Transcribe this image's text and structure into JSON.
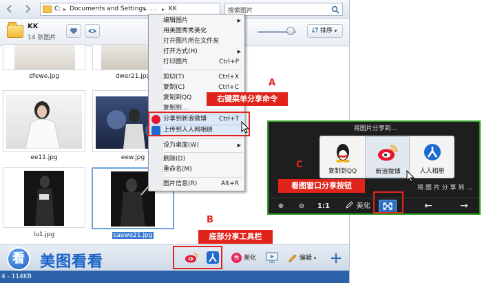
{
  "explorer": {
    "nav": {
      "back_glyph": "◄",
      "forward_glyph": "►",
      "back_icon": "back-arrow-icon",
      "forward_icon": "forward-arrow-icon"
    },
    "address": {
      "drive": "C:",
      "segment1": "Documents and Settings",
      "segment2": "...",
      "segment3": "KK"
    },
    "search": {
      "placeholder": "搜索图片",
      "icon": "search-icon"
    },
    "folder": {
      "name": "KK",
      "count": "14 张图片"
    },
    "sort_label": "排序",
    "zoom_level": 0.85,
    "thumbnails": [
      {
        "name": "dfewe.jpg",
        "selected": false
      },
      {
        "name": "dwer21.jpg",
        "selected": false
      },
      {
        "name": "ee11.jpg",
        "selected": false
      },
      {
        "name": "eew.jpg",
        "selected": false
      },
      {
        "name": "lu1.jpg",
        "selected": false
      },
      {
        "name": "saewe21.jpg",
        "selected": true
      }
    ],
    "bottom": {
      "logo_glyph": "看",
      "logo_text": "美图看看",
      "beautify_label": "美化",
      "edit_label": "编辑"
    },
    "status_text": "4 - 114KB"
  },
  "context_menu": {
    "items": [
      {
        "label": "编辑图片",
        "shortcut": "",
        "submenu": true
      },
      {
        "label": "用美图秀秀美化",
        "shortcut": "",
        "submenu": false
      },
      {
        "label": "打开图片所在文件夹",
        "shortcut": "",
        "submenu": false
      },
      {
        "label": "打开方式(H)",
        "shortcut": "",
        "submenu": true
      },
      {
        "label": "打印图片",
        "shortcut": "Ctrl+P",
        "submenu": false
      },
      {
        "label": "剪切(T)",
        "shortcut": "Ctrl+X",
        "submenu": false
      },
      {
        "label": "复制(C)",
        "shortcut": "Ctrl+C",
        "submenu": false
      },
      {
        "label": "复制到QQ",
        "shortcut": "",
        "submenu": false
      },
      {
        "label": "复制到...",
        "shortcut": "",
        "submenu": false
      },
      {
        "label": "分享到新浪微博",
        "shortcut": "Ctrl+T",
        "submenu": false
      },
      {
        "label": "上传到人人网相册",
        "shortcut": "",
        "submenu": false
      },
      {
        "label": "设为桌面(W)",
        "shortcut": "",
        "submenu": true
      },
      {
        "label": "删除(D)",
        "shortcut": "",
        "submenu": false
      },
      {
        "label": "重命名(M)",
        "shortcut": "",
        "submenu": false
      },
      {
        "label": "图片信息(R)",
        "shortcut": "Alt+R",
        "submenu": false
      }
    ]
  },
  "annotations": {
    "a_tag": "A",
    "a_callout": "右键菜单分享命令",
    "b_tag": "B",
    "b_callout": "底部分享工具栏",
    "c_tag": "C",
    "c_callout": "看图窗口分享按钮"
  },
  "viewer": {
    "share_title": "将图片分享到...",
    "options": [
      {
        "label": "复制到QQ",
        "icon": "qq-penguin-icon"
      },
      {
        "label": "新浪微博",
        "icon": "weibo-icon"
      },
      {
        "label": "人人相册",
        "icon": "renren-icon"
      }
    ],
    "share_to_text": "将 图 片 分 享 到 ...",
    "toolbar": {
      "zoom_in": "⊕",
      "zoom_out": "⊖",
      "actual_size": "1:1",
      "beautify": "美化",
      "prev": "←",
      "next": "→"
    }
  },
  "colors": {
    "accent_red": "#e0241b",
    "viewer_border_green": "#30a028",
    "selection_blue": "#3a7ad3",
    "status_blue": "#2c63a8"
  }
}
